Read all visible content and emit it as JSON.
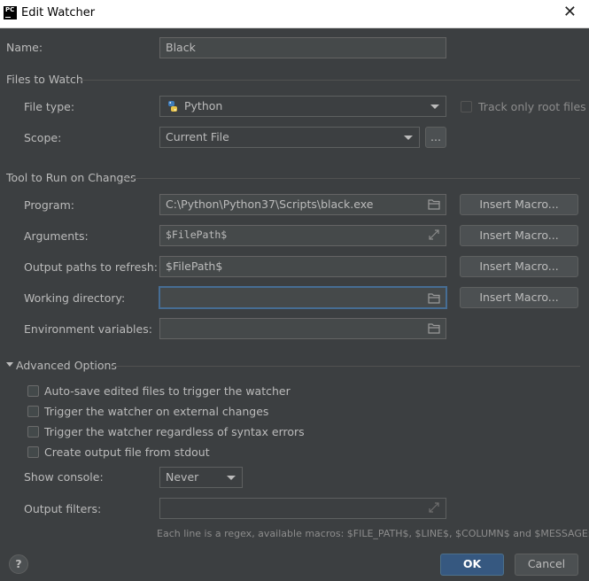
{
  "window": {
    "title": "Edit Watcher",
    "app_icon_text": "PC"
  },
  "name": {
    "label": "Name:",
    "value": "Black"
  },
  "files_to_watch": {
    "section": "Files to Watch",
    "file_type_label": "File type:",
    "file_type_value": "Python",
    "track_only_root": "Track only root files",
    "scope_label": "Scope:",
    "scope_value": "Current File",
    "scope_more": "..."
  },
  "tool": {
    "section": "Tool to Run on Changes",
    "program_label": "Program:",
    "program_value": "C:\\Python\\Python37\\Scripts\\black.exe",
    "arguments_label": "Arguments:",
    "arguments_value": "$FilePath$",
    "output_paths_label": "Output paths to refresh:",
    "output_paths_value": "$FilePath$",
    "working_dir_label": "Working directory:",
    "working_dir_value": "",
    "env_vars_label": "Environment variables:",
    "env_vars_value": "",
    "insert_macro": "Insert Macro..."
  },
  "advanced": {
    "section": "Advanced Options",
    "options": [
      "Auto-save edited files to trigger the watcher",
      "Trigger the watcher on external changes",
      "Trigger the watcher regardless of syntax errors",
      "Create output file from stdout"
    ],
    "show_console_label": "Show console:",
    "show_console_value": "Never",
    "output_filters_label": "Output filters:",
    "output_filters_value": "",
    "hint": "Each line is a regex, available macros: $FILE_PATH$, $LINE$, $COLUMN$ and $MESSAGE$"
  },
  "footer": {
    "help": "?",
    "ok": "OK",
    "cancel": "Cancel"
  },
  "icons": {
    "folder": "folder-icon",
    "expand": "expand-icon",
    "python": "python-icon",
    "dropdown": "chevron-down-icon"
  },
  "colors": {
    "background": "#3c3f41",
    "field": "#45494a",
    "focus": "#466d94",
    "primary": "#365880"
  }
}
